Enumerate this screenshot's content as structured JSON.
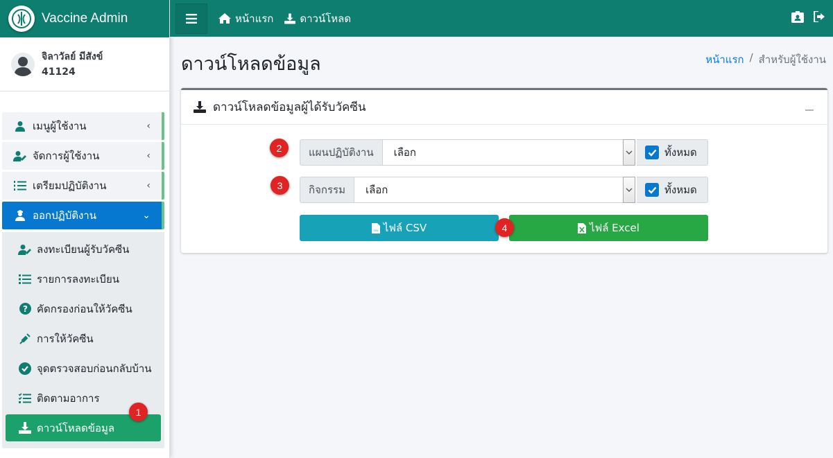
{
  "brand": {
    "title": "Vaccine Admin"
  },
  "user": {
    "name": "จิลาวัลย์ มีสังข์",
    "id": "41124"
  },
  "sidebar": {
    "items": [
      {
        "label": "เมนูผู้ใช้งาน",
        "icon": "user-icon"
      },
      {
        "label": "จัดการผู้ใช้งาน",
        "icon": "user-edit-icon"
      },
      {
        "label": "เตรียมปฏิบัติงาน",
        "icon": "list-ol-icon"
      },
      {
        "label": "ออกปฏิบัติงาน",
        "icon": "user-nurse-icon",
        "active": true
      }
    ],
    "subitems": [
      {
        "label": "ลงทะเบียนผู้รับวัคซีน",
        "icon": "user-edit-icon"
      },
      {
        "label": "รายการลงทะเบียน",
        "icon": "list-icon"
      },
      {
        "label": "คัดกรองก่อนให้วัคซีน",
        "icon": "question-circle-icon"
      },
      {
        "label": "การให้วัคซีน",
        "icon": "syringe-icon"
      },
      {
        "label": "จุดตรวจสอบก่อนกลับบ้าน",
        "icon": "check-circle-icon"
      },
      {
        "label": "ติดตามอาการ",
        "icon": "tasks-icon"
      },
      {
        "label": "ดาวน์โหลดข้อมูล",
        "icon": "download-icon",
        "active": true
      }
    ]
  },
  "topbar": {
    "home_label": "หน้าแรก",
    "download_label": "ดาวน์โหลด"
  },
  "page": {
    "title": "ดาวน์โหลดข้อมูล",
    "breadcrumb_home": "หน้าแรก",
    "breadcrumb_sep": "/",
    "breadcrumb_current": "สำหรับผู้ใช้งาน"
  },
  "card": {
    "title": "ดาวน์โหลดข้อมูลผู้ได้รับวัคซีน",
    "plan_label": "แผนปฏิบัติงาน",
    "plan_value": "เลือก",
    "activity_label": "กิจกรรม",
    "activity_value": "เลือก",
    "all_label": "ทั้งหมด",
    "csv_label": "ไฟล์ CSV",
    "excel_label": "ไฟล์ Excel"
  },
  "markers": [
    "1",
    "2",
    "3",
    "4"
  ],
  "colors": {
    "header_bg": "#0d7e70",
    "active_nav": "#0678cf",
    "active_sub": "#1da16a",
    "btn_csv": "#17a2b8",
    "btn_excel": "#28a745",
    "marker": "#e02424"
  }
}
